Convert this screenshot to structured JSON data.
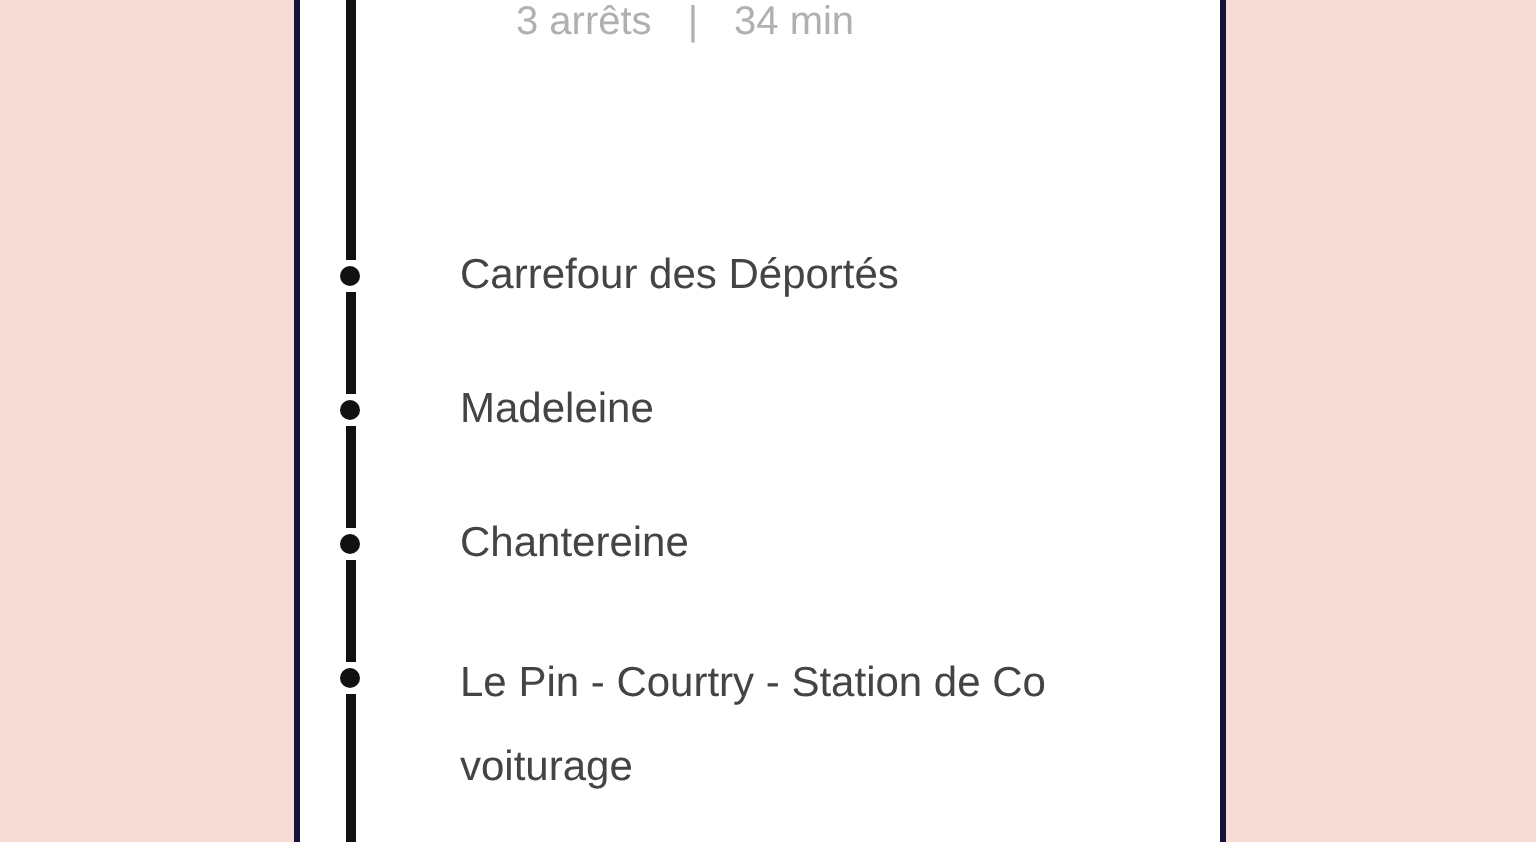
{
  "summary": {
    "stops": "3 arrêts",
    "separator": "|",
    "duration": "34 min"
  },
  "stops": [
    {
      "name": "Carrefour des Déportés"
    },
    {
      "name": "Madeleine"
    },
    {
      "name": "Chantereine"
    },
    {
      "name": "Le Pin - Courtry - Station de Co voiturage"
    }
  ]
}
